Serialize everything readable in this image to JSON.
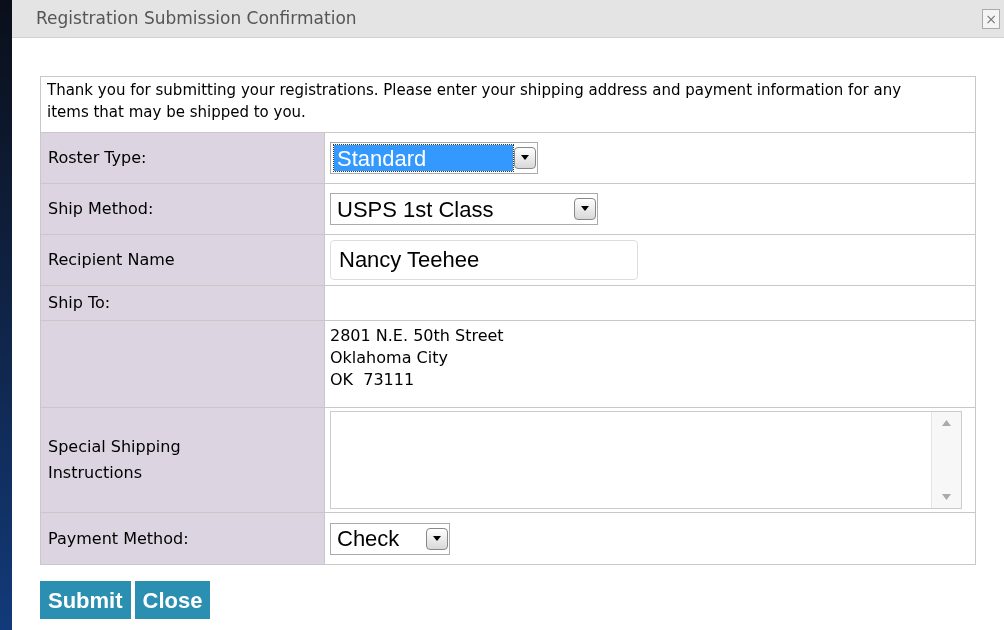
{
  "dialog": {
    "title": "Registration Submission Confirmation",
    "close": "×"
  },
  "intro": "Thank you for submitting your registrations. Please enter your shipping address and payment information for any items that may be shipped to you.",
  "rows": [
    {
      "kind": "select",
      "label": "Roster Type:",
      "value": "Standard",
      "focused": true
    },
    {
      "kind": "select",
      "label": "Ship Method:",
      "value": "USPS 1st Class",
      "focused": false
    },
    {
      "kind": "input",
      "label": "Recipient Name",
      "value": "Nancy Teehee"
    },
    {
      "kind": "text",
      "label": "Ship To:"
    },
    {
      "kind": "address",
      "lines": [
        "2801 N.E. 50th Street",
        "Oklahoma City",
        "OK  73111"
      ]
    },
    {
      "kind": "textarea",
      "label": "Special Shipping Instructions"
    },
    {
      "kind": "select",
      "label": "Payment Method:",
      "value": "Check",
      "focused": false
    }
  ],
  "buttons": [
    "Submit",
    "Close"
  ]
}
